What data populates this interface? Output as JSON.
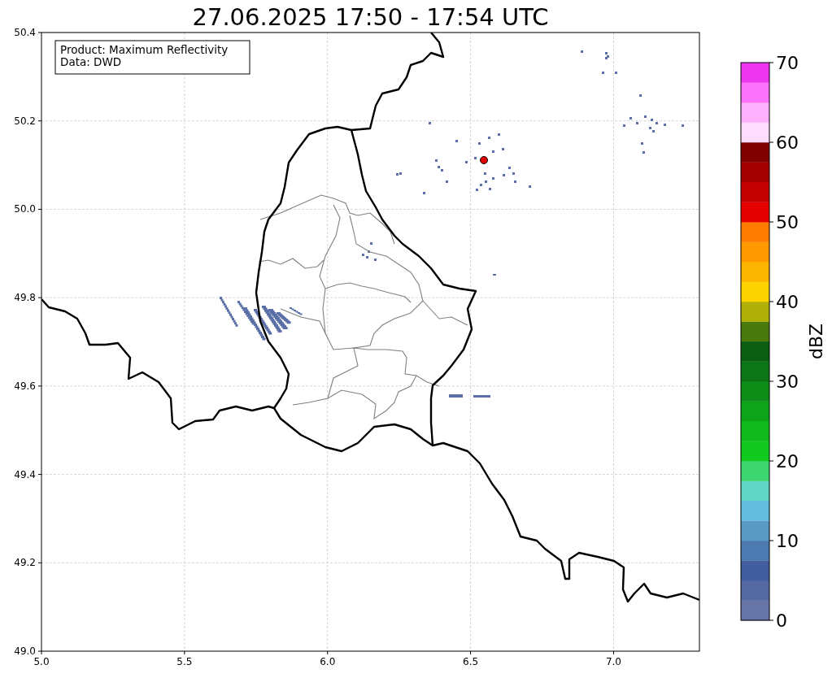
{
  "title": "27.06.2025 17:50 - 17:54 UTC",
  "legend": {
    "lines": [
      "Product: Maximum Reflectivity",
      "Data: DWD"
    ]
  },
  "map": {
    "xticks": [
      "5.0",
      "5.5",
      "6.0",
      "6.5",
      "7.0"
    ],
    "yticks": [
      "50.4",
      "50.2",
      "50.0",
      "49.8",
      "49.6",
      "49.4",
      "49.2",
      "49.0"
    ]
  },
  "colorbar": {
    "label": "dBZ",
    "ticks": [
      "70",
      "60",
      "50",
      "40",
      "30",
      "20",
      "10",
      "0"
    ],
    "bins": [
      {
        "color": "#6475a6"
      },
      {
        "color": "#5469a2"
      },
      {
        "color": "#435e9e"
      },
      {
        "color": "#4b79b0"
      },
      {
        "color": "#5a9bc6"
      },
      {
        "color": "#62bcdd"
      },
      {
        "color": "#5fd6c6"
      },
      {
        "color": "#3dd670"
      },
      {
        "color": "#11c91f"
      },
      {
        "color": "#10b91d"
      },
      {
        "color": "#0ea41a"
      },
      {
        "color": "#0d8c17"
      },
      {
        "color": "#0c7515"
      },
      {
        "color": "#0a5e12"
      },
      {
        "color": "#4a7a0d"
      },
      {
        "color": "#b0b00a"
      },
      {
        "color": "#fcd500"
      },
      {
        "color": "#fdb600"
      },
      {
        "color": "#fe9900"
      },
      {
        "color": "#ff7c00"
      },
      {
        "color": "#e50000"
      },
      {
        "color": "#c40000"
      },
      {
        "color": "#a30000"
      },
      {
        "color": "#800000"
      },
      {
        "color": "#fddcfd"
      },
      {
        "color": "#fdb1fd"
      },
      {
        "color": "#fb73fb"
      },
      {
        "color": "#ee36ee"
      }
    ]
  }
}
